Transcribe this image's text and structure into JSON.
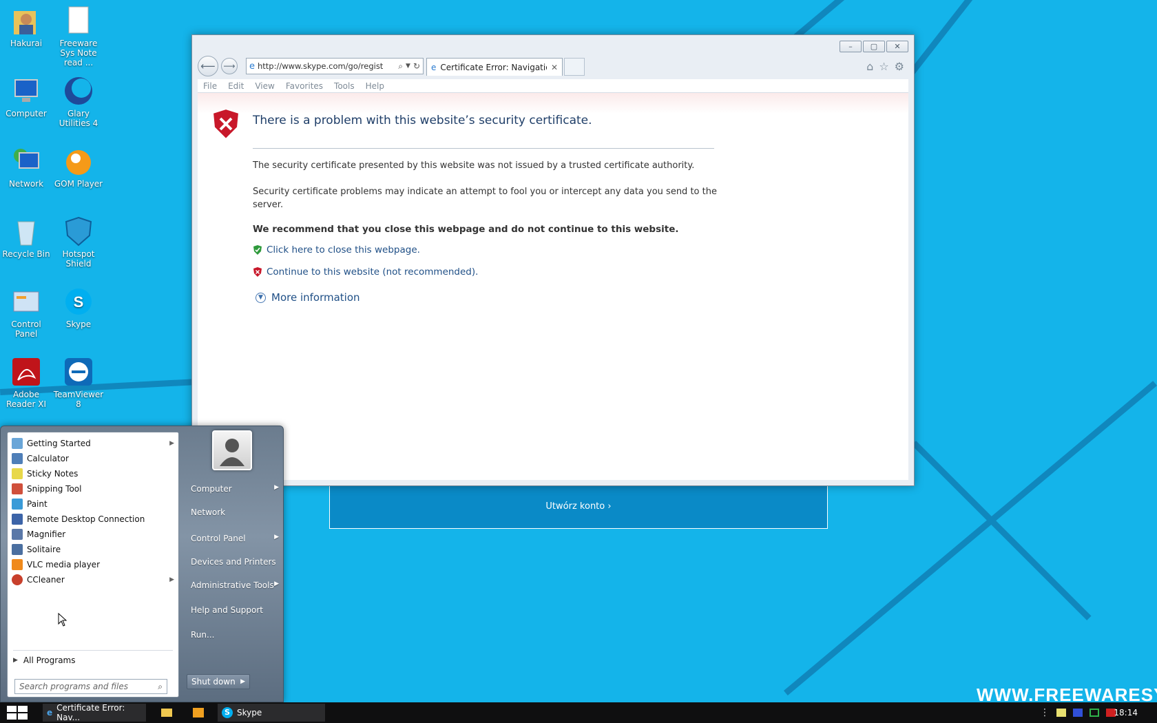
{
  "desktop": {
    "icons": [
      {
        "label": "Hakurai"
      },
      {
        "label": "Freeware Sys Note read ..."
      },
      {
        "label": "Computer"
      },
      {
        "label": "Glary Utilities 4"
      },
      {
        "label": "Network"
      },
      {
        "label": "GOM Player"
      },
      {
        "label": "Recycle Bin"
      },
      {
        "label": "Hotspot Shield"
      },
      {
        "label": "Control Panel"
      },
      {
        "label": "Skype"
      },
      {
        "label": "Adobe Reader XI"
      },
      {
        "label": "TeamViewer 8"
      }
    ],
    "watermark": "WWW.FREEWARESY"
  },
  "browser": {
    "address_url": "http://www.skype.com/go/regist",
    "tab_title": "Certificate Error: Navigatio...",
    "menu": [
      "File",
      "Edit",
      "View",
      "Favorites",
      "Tools",
      "Help"
    ],
    "page": {
      "title": "There is a problem with this website’s security certificate.",
      "para1": "The security certificate presented by this website was not issued by a trusted certificate authority.",
      "para2": "Security certificate problems may indicate an attempt to fool you or intercept any data you send to the server.",
      "recommend": "We recommend that you close this webpage and do not continue to this website.",
      "close_link": "Click here to close this webpage.",
      "continue_link": "Continue to this website (not recommended).",
      "more_info": "More information"
    }
  },
  "skype_background": {
    "button": "Utwórz konto"
  },
  "start_menu": {
    "programs": [
      {
        "label": "Getting Started",
        "submenu": true,
        "color": "#6aa6d8"
      },
      {
        "label": "Calculator",
        "submenu": false,
        "color": "#4f7fb8"
      },
      {
        "label": "Sticky Notes",
        "submenu": false,
        "color": "#e8d84a"
      },
      {
        "label": "Snipping Tool",
        "submenu": false,
        "color": "#d0503c"
      },
      {
        "label": "Paint",
        "submenu": false,
        "color": "#3a9bd8"
      },
      {
        "label": "Remote Desktop Connection",
        "submenu": false,
        "color": "#3c64a8"
      },
      {
        "label": "Magnifier",
        "submenu": false,
        "color": "#5a78a8"
      },
      {
        "label": "Solitaire",
        "submenu": false,
        "color": "#4b6fa0"
      },
      {
        "label": "VLC media player",
        "submenu": false,
        "color": "#f08a1c"
      },
      {
        "label": "CCleaner",
        "submenu": true,
        "color": "#c8402c"
      }
    ],
    "all_programs": "All Programs",
    "search_placeholder": "Search programs and files",
    "right_items": [
      {
        "label": "Computer",
        "submenu": true
      },
      {
        "label": "Network",
        "submenu": false
      },
      {
        "label": "Control Panel",
        "submenu": true
      },
      {
        "label": "Devices and Printers",
        "submenu": false
      },
      {
        "label": "Administrative Tools",
        "submenu": true
      },
      {
        "label": "Help and Support",
        "submenu": false
      },
      {
        "label": "Run...",
        "submenu": false
      }
    ],
    "shutdown": "Shut down"
  },
  "taskbar": {
    "items": [
      {
        "label": "Certificate Error: Nav..."
      },
      {
        "label": ""
      },
      {
        "label": ""
      },
      {
        "label": "Skype"
      }
    ],
    "clock": "18:14"
  }
}
